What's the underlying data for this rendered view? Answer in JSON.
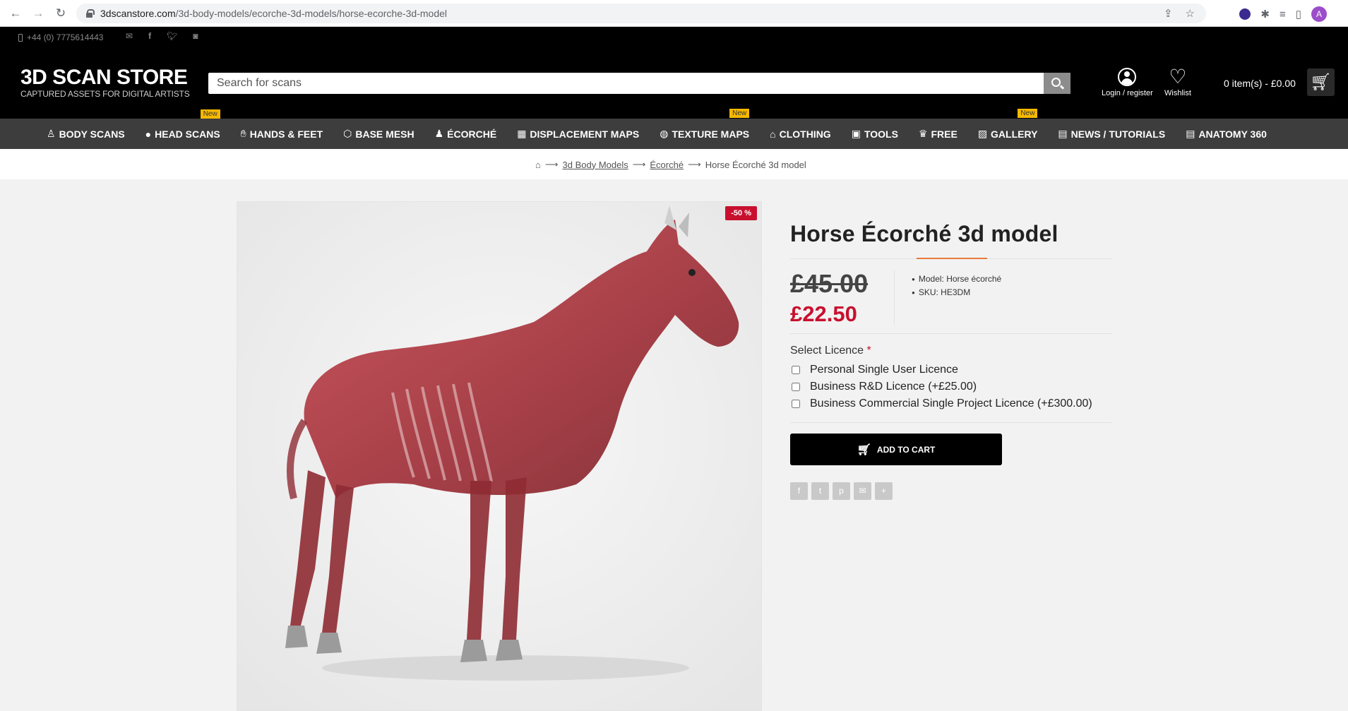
{
  "browser": {
    "url_host": "3dscanstore.com",
    "url_path": "/3d-body-models/ecorche-3d-models/horse-ecorche-3d-model",
    "profile_initial": "A"
  },
  "topbar": {
    "phone": "+44 (0) 7775614443"
  },
  "header": {
    "logo_main": "3D SCAN STORE",
    "logo_tag": "CAPTURED ASSETS FOR DIGITAL ARTISTS",
    "search_placeholder": "Search for scans",
    "login_label": "Login / register",
    "wishlist_label": "Wishlist",
    "cart_total": "0 item(s) - £0.00"
  },
  "nav": {
    "items": [
      {
        "label": "BODY SCANS",
        "icon": "body-icon",
        "new": ""
      },
      {
        "label": "HEAD SCANS",
        "icon": "head-icon",
        "new": "New"
      },
      {
        "label": "HANDS & FEET",
        "icon": "hands-icon",
        "new": ""
      },
      {
        "label": "BASE MESH",
        "icon": "mesh-icon",
        "new": ""
      },
      {
        "label": "ÉCORCHÉ",
        "icon": "ecorche-icon",
        "new": ""
      },
      {
        "label": "DISPLACEMENT MAPS",
        "icon": "map-icon",
        "new": ""
      },
      {
        "label": "TEXTURE MAPS",
        "icon": "palette-icon",
        "new": "New"
      },
      {
        "label": "CLOTHING",
        "icon": "shirt-icon",
        "new": ""
      },
      {
        "label": "TOOLS",
        "icon": "tools-icon",
        "new": ""
      },
      {
        "label": "FREE",
        "icon": "crown-icon",
        "new": ""
      },
      {
        "label": "GALLERY",
        "icon": "image-icon",
        "new": "New"
      },
      {
        "label": "NEWS / TUTORIALS",
        "icon": "news-icon",
        "new": ""
      },
      {
        "label": "ANATOMY 360",
        "icon": "news-icon",
        "new": ""
      }
    ]
  },
  "breadcrumb": {
    "items": [
      "3d Body Models",
      "Écorché",
      "Horse Écorché 3d model"
    ]
  },
  "product": {
    "discount": "-50 %",
    "title": "Horse Écorché 3d model",
    "old_price": "£45.00",
    "new_price": "£22.50",
    "model": "Model: Horse écorché",
    "sku": "SKU: HE3DM",
    "select_licence": "Select Licence",
    "licences": [
      "Personal Single User Licence",
      "Business R&D Licence  (+£25.00)",
      "Business Commercial Single Project Licence  (+£300.00)"
    ],
    "add_to_cart": "ADD TO CART"
  },
  "colors": {
    "accent_red": "#c8102e",
    "nav_bg": "#3d3d3d",
    "badge_yellow": "#f5b800",
    "title_underline": "#e87a3c"
  }
}
